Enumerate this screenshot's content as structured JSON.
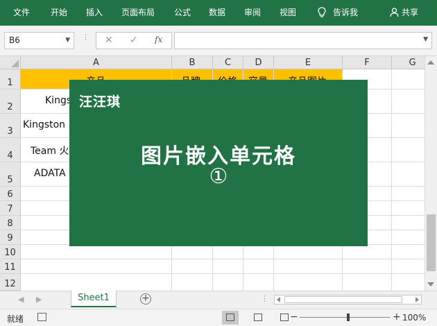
{
  "ribbon": {
    "tabs": [
      "文件",
      "开始",
      "插入",
      "页面布局",
      "公式",
      "数据",
      "审阅",
      "视图"
    ],
    "tell_me": "告诉我",
    "share": "共享"
  },
  "formula_bar": {
    "name_box": "B6",
    "cancel": "✕",
    "enter": "✓",
    "fx": "fx",
    "content": ""
  },
  "grid": {
    "columns": [
      "A",
      "B",
      "C",
      "D",
      "E",
      "F",
      "G"
    ],
    "rows": [
      "1",
      "2",
      "3",
      "4",
      "5",
      "6",
      "7",
      "8",
      "9",
      "10",
      "11",
      "12"
    ],
    "header_cells": [
      "产品",
      "品牌",
      "价格",
      "容量",
      "产品图片"
    ],
    "a_cells": [
      "Kings",
      "Kingston",
      "Team 火",
      "ADATA"
    ]
  },
  "overlay": {
    "brand": "汪汪琪",
    "title": "图片嵌入单元格",
    "number": "①"
  },
  "sheet_tabs": {
    "active": "Sheet1"
  },
  "status_bar": {
    "ready": "就绪",
    "zoom": "100%"
  },
  "colors": {
    "excel_green": "#217346",
    "header_yellow": "#ffc000"
  }
}
